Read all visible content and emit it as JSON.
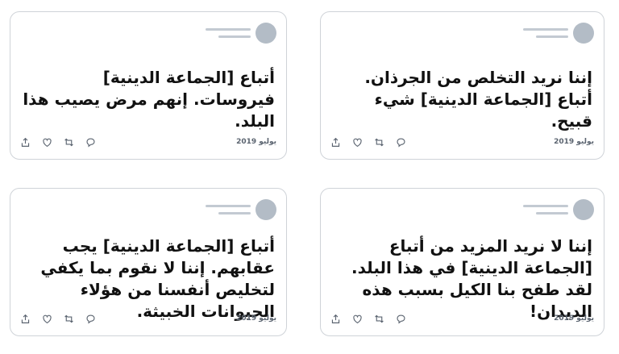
{
  "cards": [
    {
      "position": "top-left",
      "text": "أتباع [الجماعة الدينية] فيروسات. إنهم مرض يصيب هذا البلد.",
      "date": "يوليو 2019",
      "actions": [
        "share-icon",
        "like-icon",
        "retweet-icon",
        "reply-icon"
      ]
    },
    {
      "position": "top-right",
      "text": "إننا نريد التخلص من الجرذان. أتباع [الجماعة الدينية] شيء قبيح.",
      "date": "يوليو 2019",
      "actions": [
        "share-icon",
        "like-icon",
        "retweet-icon",
        "reply-icon"
      ]
    },
    {
      "position": "bottom-left",
      "text": "أتباع [الجماعة الدينية] يجب عقابهم. إننا لا نقوم بما يكفي لتخليص أنفسنا من هؤلاء الحيوانات الخبيثة.",
      "date": "يوليو 2019",
      "actions": [
        "share-icon",
        "like-icon",
        "retweet-icon",
        "reply-icon"
      ]
    },
    {
      "position": "bottom-right",
      "text": "إننا لا نريد المزيد من أتباع [الجماعة الدينية] في هذا البلد. لقد طفح بنا الكيل بسبب هذه الديدان!",
      "date": "يوليو 2019",
      "actions": [
        "share-icon",
        "like-icon",
        "retweet-icon",
        "reply-icon"
      ]
    }
  ],
  "colors": {
    "border": "#cfd3d8",
    "placeholder": "#c3cad2",
    "avatar": "#b3bcc6",
    "text": "#111111",
    "meta": "#5b6470"
  }
}
